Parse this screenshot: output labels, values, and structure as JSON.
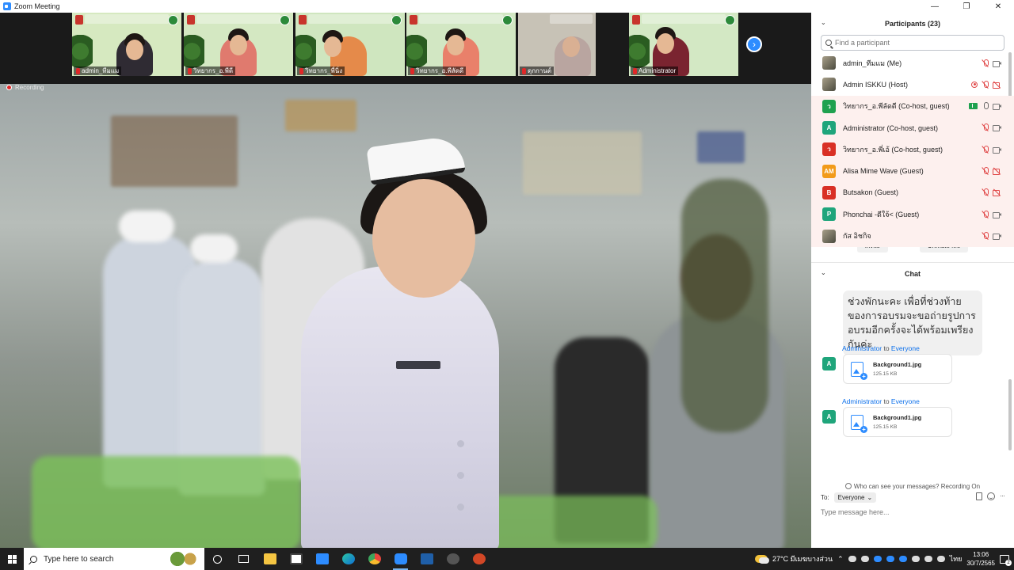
{
  "window": {
    "title": "Zoom Meeting"
  },
  "gallery": {
    "tiles": [
      {
        "name": "admin_ทีมแม",
        "bg": "#d6e9c0"
      },
      {
        "name": "วิทยากร_อ.พีดี",
        "bg": "#d4e8c2"
      },
      {
        "name": "วิทยากร_พี่นิ่ง",
        "bg": "#cfe6bf"
      },
      {
        "name": "วิทยากร_อ.พีลัดดี",
        "bg": "#d2e7c3"
      },
      {
        "name": "ดุกกานต์",
        "bg": "#c7c2b6"
      },
      {
        "name": "Administrator",
        "bg": "#d3e8c4"
      }
    ]
  },
  "recording": {
    "label": "Recording"
  },
  "participants": {
    "header": "Participants (23)",
    "search_placeholder": "Find a participant",
    "rows": [
      {
        "name": "admin_ทีมแม (Me)",
        "avatar": "",
        "avatar_bg": "photo",
        "icons": [
          "mic-off",
          "cam-on"
        ],
        "highlight": false
      },
      {
        "name": "Admin ISKKU (Host)",
        "avatar": "",
        "avatar_bg": "photo",
        "icons": [
          "rec",
          "mic-off",
          "cam-off"
        ],
        "highlight": false
      },
      {
        "name": "วิทยากร_อ.พีลัดดี (Co-host, guest)",
        "avatar": "ว",
        "avatar_bg": "#1fa14f",
        "icons": [
          "share",
          "mic-on",
          "cam-on"
        ],
        "highlight": true
      },
      {
        "name": "Administrator (Co-host, guest)",
        "avatar": "A",
        "avatar_bg": "#1fa57b",
        "icons": [
          "mic-off",
          "cam-on"
        ],
        "highlight": true
      },
      {
        "name": "วิทยากร_อ.พี่เอ้ (Co-host, guest)",
        "avatar": "ว",
        "avatar_bg": "#d93025",
        "icons": [
          "mic-off",
          "cam-on"
        ],
        "highlight": true
      },
      {
        "name": "Alisa Mime Wave (Guest)",
        "avatar": "AM",
        "avatar_bg": "#f29b1a",
        "icons": [
          "mic-off",
          "cam-off"
        ],
        "highlight": true
      },
      {
        "name": "Butsakon (Guest)",
        "avatar": "B",
        "avatar_bg": "#d93025",
        "icons": [
          "mic-off",
          "cam-off"
        ],
        "highlight": true
      },
      {
        "name": "Phonchai -ดีใจ้< (Guest)",
        "avatar": "P",
        "avatar_bg": "#1fa57b",
        "icons": [
          "mic-off",
          "cam-on"
        ],
        "highlight": true
      },
      {
        "name": "กัส อิชกิจ",
        "avatar": "",
        "avatar_bg": "photo",
        "icons": [
          "mic-off",
          "cam-on"
        ],
        "highlight": true
      }
    ],
    "invite_label": "Invite",
    "unmute_label": "Unmute Me"
  },
  "chat": {
    "header": "Chat",
    "bubble_text": "ช่วงพักนะคะ เพื่อที่ช่วงท้ายของการอบรมจะขอถ่ายรูปการอบรมอีกครั้งจะได้พร้อมเพรียงกันค่ะ",
    "messages": [
      {
        "sender": "Administrator",
        "to_word": "to",
        "recipient": "Everyone",
        "avatar": "A",
        "file_name": "Background1.jpg",
        "file_size": "125.15 KB"
      },
      {
        "sender": "Administrator",
        "to_word": "to",
        "recipient": "Everyone",
        "avatar": "A",
        "file_name": "Background1.jpg",
        "file_size": "125.15 KB"
      }
    ],
    "privacy_note": "Who can see your messages? Recording On",
    "to_label": "To:",
    "to_value": "Everyone",
    "input_placeholder": "Type message here..."
  },
  "taskbar": {
    "search_placeholder": "Type here to search",
    "weather": "27°C  มีเมฆบางส่วน",
    "lang": "ไทย",
    "time": "13:06",
    "date": "30/7/2565",
    "notification_count": "2"
  }
}
